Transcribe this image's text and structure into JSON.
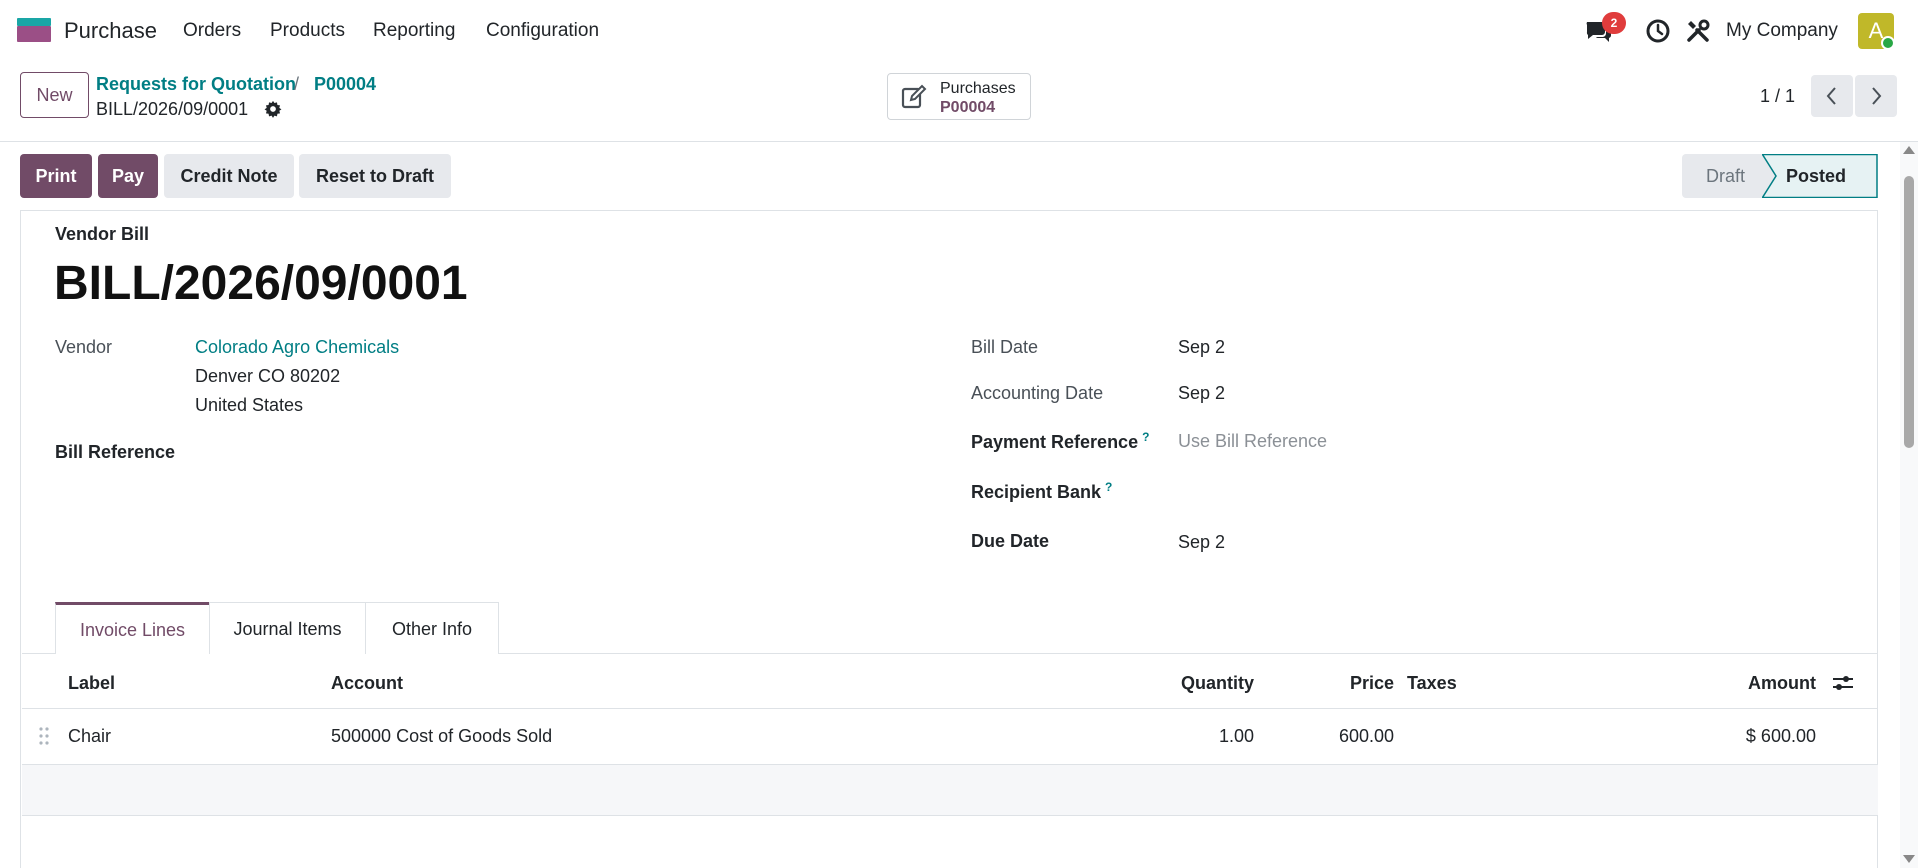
{
  "app": {
    "name": "Purchase"
  },
  "menu": [
    "Orders",
    "Products",
    "Reporting",
    "Configuration"
  ],
  "systray": {
    "chat_count": "2",
    "company": "My Company",
    "avatar_letter": "A"
  },
  "control_panel": {
    "new_label": "New",
    "breadcrumb": [
      "Requests for Quotation",
      "P00004"
    ],
    "breadcrumb_sep": "/",
    "current_record": "BILL/2026/09/0001",
    "smart_button": {
      "title": "Purchases",
      "value": "P00004"
    },
    "pager": "1 / 1"
  },
  "actions": {
    "print": "Print",
    "pay": "Pay",
    "credit_note": "Credit Note",
    "reset_to_draft": "Reset to Draft"
  },
  "statusbar": {
    "draft": "Draft",
    "posted": "Posted",
    "current": "Posted"
  },
  "form": {
    "doc_type": "Vendor Bill",
    "title": "BILL/2026/09/0001",
    "vendor_label": "Vendor",
    "vendor_name": "Colorado Agro Chemicals",
    "vendor_addr1": "Denver CO 80202",
    "vendor_addr2": "United States",
    "bill_reference_label": "Bill Reference",
    "bill_date_label": "Bill Date",
    "bill_date": "Sep 2",
    "accounting_date_label": "Accounting Date",
    "accounting_date": "Sep 2",
    "payment_reference_label": "Payment Reference",
    "payment_reference_placeholder": "Use Bill Reference",
    "recipient_bank_label": "Recipient Bank",
    "due_date_label": "Due Date",
    "due_date": "Sep 2",
    "help_mark": "?"
  },
  "tabs": [
    "Invoice Lines",
    "Journal Items",
    "Other Info"
  ],
  "table": {
    "headers": {
      "label": "Label",
      "account": "Account",
      "quantity": "Quantity",
      "price": "Price",
      "taxes": "Taxes",
      "amount": "Amount"
    },
    "rows": [
      {
        "label": "Chair",
        "account": "500000 Cost of Goods Sold",
        "quantity": "1.00",
        "price": "600.00",
        "taxes": "",
        "amount": "$ 600.00"
      }
    ]
  },
  "colors": {
    "brand": "#714B67",
    "link": "#017e84",
    "badge": "#e03c3c"
  }
}
